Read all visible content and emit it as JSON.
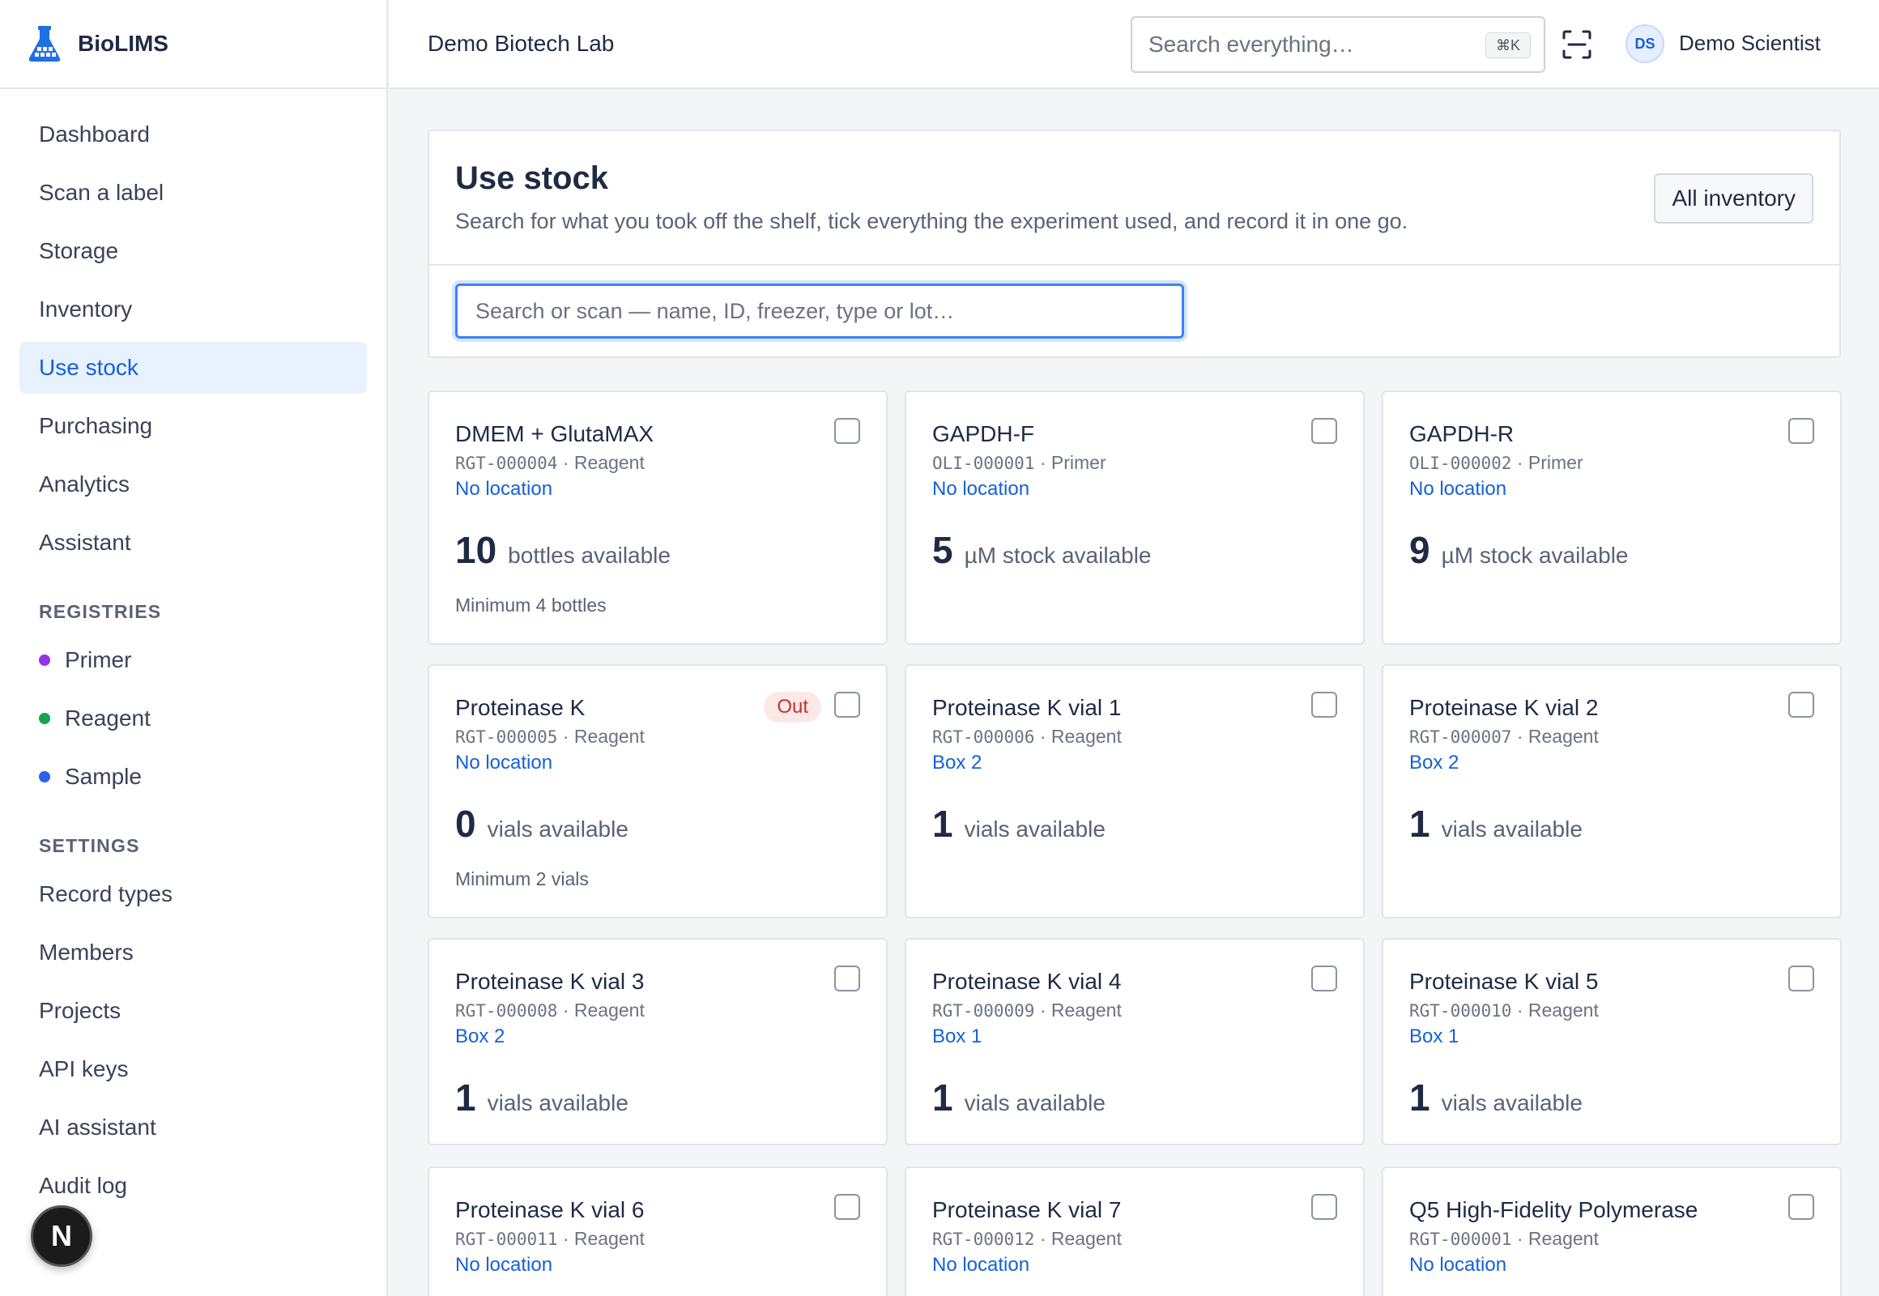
{
  "brand": {
    "name": "BioLIMS"
  },
  "sidebar": {
    "nav": [
      {
        "label": "Dashboard"
      },
      {
        "label": "Scan a label"
      },
      {
        "label": "Storage"
      },
      {
        "label": "Inventory"
      },
      {
        "label": "Use stock",
        "active": true
      },
      {
        "label": "Purchasing"
      },
      {
        "label": "Analytics"
      },
      {
        "label": "Assistant"
      }
    ],
    "registries_heading": "REGISTRIES",
    "registries": [
      {
        "label": "Primer",
        "color": "#9333ea"
      },
      {
        "label": "Reagent",
        "color": "#16a34a"
      },
      {
        "label": "Sample",
        "color": "#2563eb"
      }
    ],
    "settings_heading": "SETTINGS",
    "settings": [
      {
        "label": "Record types"
      },
      {
        "label": "Members"
      },
      {
        "label": "Projects"
      },
      {
        "label": "API keys"
      },
      {
        "label": "AI assistant"
      },
      {
        "label": "Audit log"
      }
    ],
    "floating_badge": "N"
  },
  "header": {
    "org": "Demo Biotech Lab",
    "search_placeholder": "Search everything…",
    "shortcut": "⌘K",
    "user_initials": "DS",
    "user_name": "Demo Scientist"
  },
  "panel": {
    "title": "Use stock",
    "subtitle": "Search for what you took off the shelf, tick everything the experiment used, and record it in one go.",
    "all_inventory": "All inventory",
    "search_placeholder": "Search or scan — name, ID, freezer, type or lot…"
  },
  "cards": [
    {
      "name": "DMEM + GlutaMAX",
      "code": "RGT-000004",
      "type": "Reagent",
      "location": "No location",
      "qty": "10",
      "unit": "bottles available",
      "min": "Minimum 4 bottles",
      "out": ""
    },
    {
      "name": "GAPDH-F",
      "code": "OLI-000001",
      "type": "Primer",
      "location": "No location",
      "qty": "5",
      "unit": "µM stock available",
      "min": "",
      "out": ""
    },
    {
      "name": "GAPDH-R",
      "code": "OLI-000002",
      "type": "Primer",
      "location": "No location",
      "qty": "9",
      "unit": "µM stock available",
      "min": "",
      "out": ""
    },
    {
      "name": "Proteinase K",
      "code": "RGT-000005",
      "type": "Reagent",
      "location": "No location",
      "qty": "0",
      "unit": "vials available",
      "min": "Minimum 2 vials",
      "out": "Out"
    },
    {
      "name": "Proteinase K vial 1",
      "code": "RGT-000006",
      "type": "Reagent",
      "location": "Box 2",
      "qty": "1",
      "unit": "vials available",
      "min": "",
      "out": ""
    },
    {
      "name": "Proteinase K vial 2",
      "code": "RGT-000007",
      "type": "Reagent",
      "location": "Box 2",
      "qty": "1",
      "unit": "vials available",
      "min": "",
      "out": ""
    },
    {
      "name": "Proteinase K vial 3",
      "code": "RGT-000008",
      "type": "Reagent",
      "location": "Box 2",
      "qty": "1",
      "unit": "vials available",
      "min": "",
      "out": ""
    },
    {
      "name": "Proteinase K vial 4",
      "code": "RGT-000009",
      "type": "Reagent",
      "location": "Box 1",
      "qty": "1",
      "unit": "vials available",
      "min": "",
      "out": ""
    },
    {
      "name": "Proteinase K vial 5",
      "code": "RGT-000010",
      "type": "Reagent",
      "location": "Box 1",
      "qty": "1",
      "unit": "vials available",
      "min": "",
      "out": ""
    },
    {
      "name": "Proteinase K vial 6",
      "code": "RGT-000011",
      "type": "Reagent",
      "location": "No location",
      "qty": "",
      "unit": "",
      "min": "",
      "out": ""
    },
    {
      "name": "Proteinase K vial 7",
      "code": "RGT-000012",
      "type": "Reagent",
      "location": "No location",
      "qty": "",
      "unit": "",
      "min": "",
      "out": ""
    },
    {
      "name": "Q5 High-Fidelity Polymerase",
      "code": "RGT-000001",
      "type": "Reagent",
      "location": "No location",
      "qty": "",
      "unit": "",
      "min": "",
      "out": ""
    }
  ]
}
